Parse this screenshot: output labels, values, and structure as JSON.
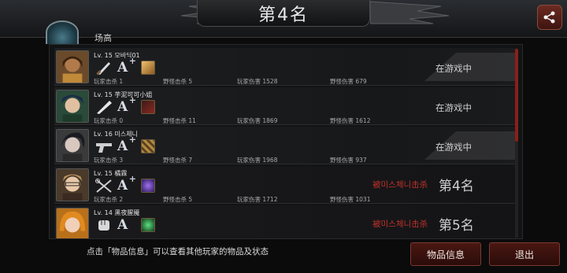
{
  "header": {
    "title": "第4名",
    "tab_fragment": "场高"
  },
  "players": [
    {
      "level_name": "Lv. 15 모바딕01",
      "grade": "A",
      "grade_plus": "+",
      "weapon": "knife",
      "player_kills": "玩家击杀 1",
      "monster_kills": "野怪击杀 5",
      "player_damage": "玩家伤害 1528",
      "monster_damage": "野怪伤害 679",
      "status": "在游戏中"
    },
    {
      "level_name": "Lv. 15 芋泥可可小姐",
      "grade": "A",
      "grade_plus": "+",
      "weapon": "bat",
      "player_kills": "玩家击杀 0",
      "monster_kills": "野怪击杀 11",
      "player_damage": "玩家伤害 1869",
      "monster_damage": "野怪伤害 1612",
      "status": "在游戏中"
    },
    {
      "level_name": "Lv. 16 미스체니",
      "grade": "A",
      "grade_plus": "+",
      "weapon": "pistol",
      "player_kills": "玩家击杀 3",
      "monster_kills": "野怪击杀 7",
      "player_damage": "玩家伤害 1968",
      "monster_damage": "野怪伤害 937",
      "status": "在游戏中"
    },
    {
      "level_name": "Lv. 15 橘霖",
      "grade": "A",
      "grade_plus": "+",
      "weapon": "scissors",
      "player_kills": "玩家击杀 2",
      "monster_kills": "野怪击杀 5",
      "player_damage": "玩家伤害 1712",
      "monster_damage": "野怪伤害 1031",
      "killed_by": "被미스체니击杀",
      "rank": "第4名"
    },
    {
      "level_name": "Lv. 14 黑夜腥魇",
      "grade": "A",
      "grade_plus": "",
      "weapon": "glove",
      "player_kills": "",
      "monster_kills": "",
      "player_damage": "",
      "monster_damage": "",
      "killed_by": "被미스체니击杀",
      "rank": "第5名"
    }
  ],
  "footer": {
    "hint": "点击「物品信息」可以查看其他玩家的物品及状态",
    "items_button": "物品信息",
    "exit_button": "退出"
  },
  "colors": {
    "accent_red": "#c2322a",
    "button_bg": "#4a1712"
  },
  "icons": [
    "share-icon",
    "knife-icon",
    "bat-icon",
    "pistol-icon",
    "scissors-icon",
    "glove-icon"
  ]
}
